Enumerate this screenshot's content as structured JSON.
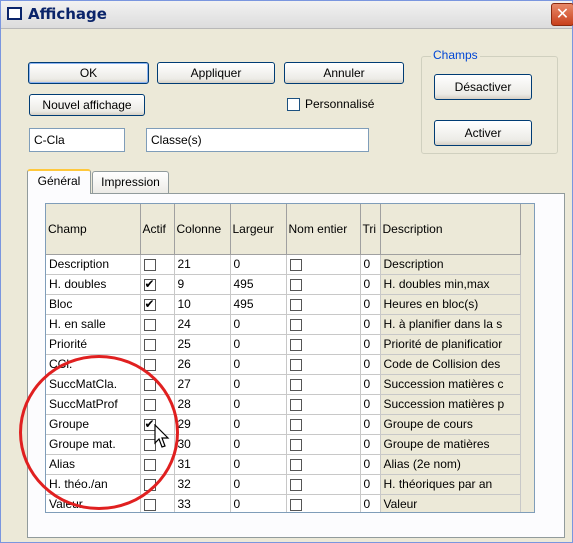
{
  "window": {
    "title": "Affichage",
    "close_glyph": "✕"
  },
  "buttons": {
    "ok": "OK",
    "apply": "Appliquer",
    "cancel": "Annuler",
    "new_view": "Nouvel affichage"
  },
  "champs_group": {
    "label": "Champs",
    "deactivate": "Désactiver",
    "activate": "Activer"
  },
  "personalized": {
    "label": "Personnalisé",
    "checked": false
  },
  "fields": {
    "code": "C-Cla",
    "name": "Classe(s)"
  },
  "tabs": [
    {
      "label": "Général",
      "active": true
    },
    {
      "label": "Impression",
      "active": false
    }
  ],
  "grid": {
    "columns": [
      "Champ",
      "Actif",
      "Colonne",
      "Largeur",
      "Nom entier",
      "Tri",
      "Description"
    ],
    "rows": [
      {
        "champ": "Description",
        "actif": false,
        "colonne": "21",
        "largeur": "0",
        "nom_entier": false,
        "tri": "0",
        "description": "Description"
      },
      {
        "champ": "H. doubles",
        "actif": true,
        "colonne": "9",
        "largeur": "495",
        "nom_entier": false,
        "tri": "0",
        "description": "H. doubles min,max"
      },
      {
        "champ": "Bloc",
        "actif": true,
        "colonne": "10",
        "largeur": "495",
        "nom_entier": false,
        "tri": "0",
        "description": "Heures en bloc(s)"
      },
      {
        "champ": "H. en salle",
        "actif": false,
        "colonne": "24",
        "largeur": "0",
        "nom_entier": false,
        "tri": "0",
        "description": "H. à planifier dans la s"
      },
      {
        "champ": "Priorité",
        "actif": false,
        "colonne": "25",
        "largeur": "0",
        "nom_entier": false,
        "tri": "0",
        "description": "Priorité de planificatior"
      },
      {
        "champ": "CCl.",
        "actif": false,
        "colonne": "26",
        "largeur": "0",
        "nom_entier": false,
        "tri": "0",
        "description": "Code de Collision des"
      },
      {
        "champ": "SuccMatCla.",
        "actif": false,
        "colonne": "27",
        "largeur": "0",
        "nom_entier": false,
        "tri": "0",
        "description": "Succession matières c"
      },
      {
        "champ": "SuccMatProf",
        "actif": false,
        "colonne": "28",
        "largeur": "0",
        "nom_entier": false,
        "tri": "0",
        "description": "Succession matières p"
      },
      {
        "champ": "Groupe",
        "actif": true,
        "colonne": "29",
        "largeur": "0",
        "nom_entier": false,
        "tri": "0",
        "description": "Groupe de cours"
      },
      {
        "champ": "Groupe mat.",
        "actif": false,
        "colonne": "30",
        "largeur": "0",
        "nom_entier": false,
        "tri": "0",
        "description": "Groupe de matières"
      },
      {
        "champ": "Alias",
        "actif": false,
        "colonne": "31",
        "largeur": "0",
        "nom_entier": false,
        "tri": "0",
        "description": "Alias (2e nom)"
      },
      {
        "champ": "H. théo./an",
        "actif": false,
        "colonne": "32",
        "largeur": "0",
        "nom_entier": false,
        "tri": "0",
        "description": "H. théoriques par an"
      },
      {
        "champ": "Valeur",
        "actif": false,
        "colonne": "33",
        "largeur": "0",
        "nom_entier": false,
        "tri": "0",
        "description": "Valeur"
      }
    ]
  },
  "icons": {
    "scroll_up": "chevron-up-icon",
    "scroll_down": "chevron-down-icon",
    "cursor": "mouse-pointer-icon"
  },
  "colors": {
    "title_text": "#0a246a",
    "annotation": "#e02020",
    "groupbox_label": "#0046d5"
  }
}
